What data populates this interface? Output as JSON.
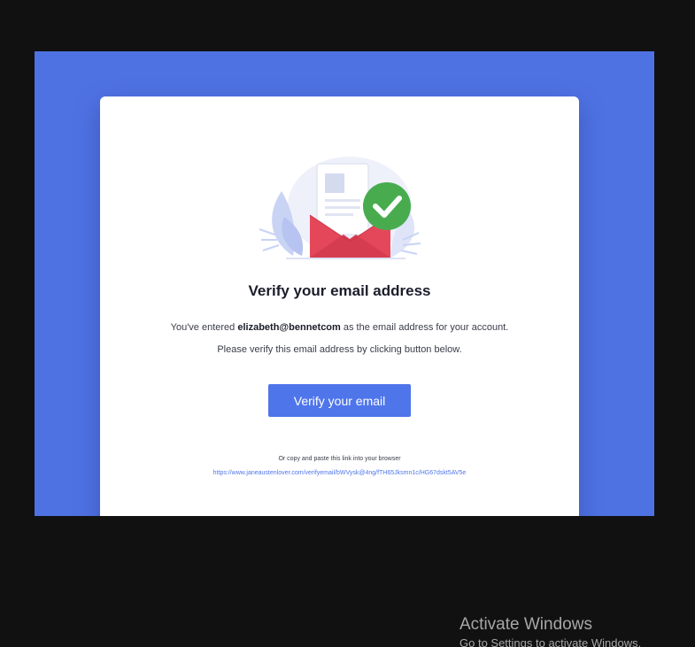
{
  "email_card": {
    "title": "Verify your email address",
    "line1_prefix": "You've entered ",
    "email": "elizabeth@bennetcom",
    "line1_suffix": " as the email address for your account.",
    "line2": "Please verify this email address by clicking button below.",
    "button_label": "Verify your email",
    "copy_note": "Or copy and paste this link into your browser",
    "link": "https://www.janeaustenlover.com/verifyemail/bWVysk@4ng/fTH65Jksmn1c/HG67dskt5AV5e",
    "illustration_icons": [
      "document-icon",
      "envelope-icon",
      "checkmark-icon",
      "leaf-icon"
    ]
  },
  "watermark": {
    "title": "Activate Windows",
    "subtitle": "Go to Settings to activate Windows."
  },
  "colors": {
    "screen_background": "#111111",
    "hero_background": "#4f72e3",
    "card_background": "#ffffff",
    "button": "#4f75ea",
    "envelope": "#e5475a",
    "check_badge": "#48ac4f",
    "link": "#4f75ea"
  }
}
